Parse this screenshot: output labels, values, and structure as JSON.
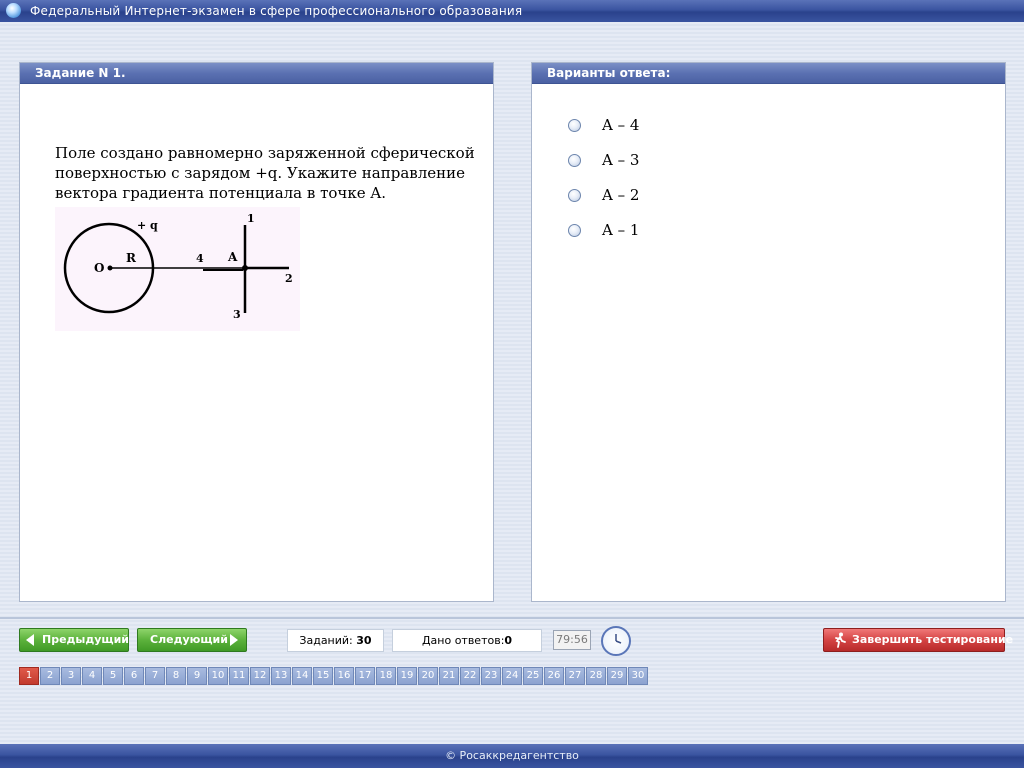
{
  "window": {
    "title": "Федеральный Интернет-экзамен в сфере профессионального образования"
  },
  "task_panel": {
    "header": "Задание N 1.",
    "question": "Поле создано равномерно заряженной сферической поверхностью с зарядом +q. Укажите направление вектора градиента потенциала в точке A.",
    "figure_labels": {
      "center": "O",
      "radius": "R",
      "charge": "+ q",
      "point": "A",
      "dir1": "1",
      "dir2": "2",
      "dir3": "3",
      "dir4": "4"
    }
  },
  "answers_panel": {
    "header": "Варианты ответа:",
    "options": [
      {
        "label": "A – 4"
      },
      {
        "label": "A – 3"
      },
      {
        "label": "A – 2"
      },
      {
        "label": "A – 1"
      }
    ]
  },
  "toolbar": {
    "prev_label": "Предыдущий",
    "next_label": "Следующий",
    "tasks_label": "Заданий:",
    "tasks_count": "30",
    "answers_label": "Дано ответов:",
    "answers_count": "0",
    "timer": "79:56",
    "finish_label": "Завершить тестирование"
  },
  "pagination": {
    "pages": [
      "1",
      "2",
      "3",
      "4",
      "5",
      "6",
      "7",
      "8",
      "9",
      "10",
      "11",
      "12",
      "13",
      "14",
      "15",
      "16",
      "17",
      "18",
      "19",
      "20",
      "21",
      "22",
      "23",
      "24",
      "25",
      "26",
      "27",
      "28",
      "29",
      "30"
    ],
    "active": "1"
  },
  "footer": {
    "text": "© Росаккредагентство"
  },
  "colors": {
    "header_blue": "#4b61a3",
    "green_button": "#5cb23c",
    "red_button": "#d44444",
    "active_page": "#c23a2e",
    "page_button": "#8ba2d0"
  }
}
